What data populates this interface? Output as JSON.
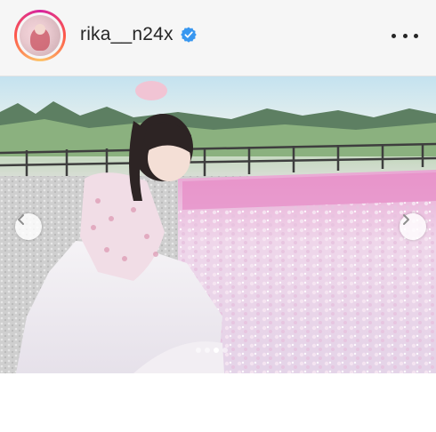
{
  "post": {
    "username": "rika__n24x",
    "verified": true,
    "avatar_icon": "profile-avatar",
    "more_icon": "more-options-icon",
    "carousel": {
      "prev_icon": "chevron-left-icon",
      "next_icon": "chevron-right-icon",
      "total_slides": 4,
      "active_slide": 3
    }
  },
  "colors": {
    "verified_badge": "#3897f0",
    "story_ring": [
      "#d6249f",
      "#fd5949",
      "#fdc468"
    ],
    "text": "#262626"
  }
}
